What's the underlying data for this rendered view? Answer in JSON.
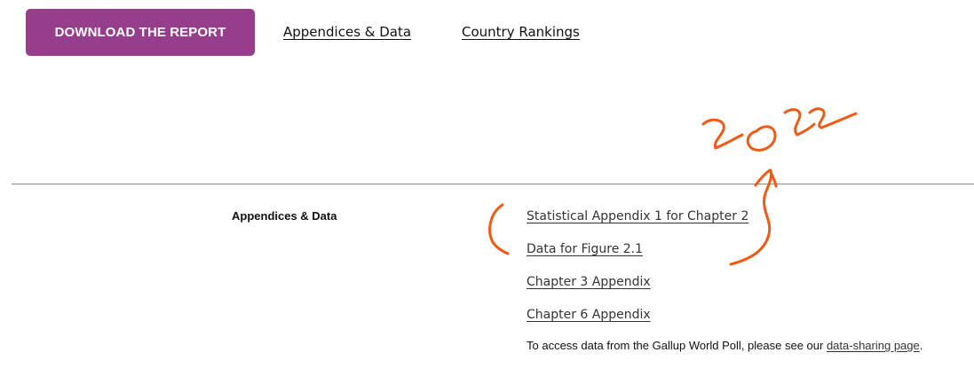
{
  "header": {
    "download_label": "DOWNLOAD THE REPORT",
    "nav_links": [
      "Appendices & Data",
      "Country Rankings"
    ]
  },
  "section": {
    "title": "Appendices & Data",
    "links": [
      "Statistical Appendix 1 for Chapter 2",
      "Data for Figure 2.1",
      "Chapter 3 Appendix",
      "Chapter 6 Appendix"
    ],
    "note_prefix": "To access data from the Gallup World Poll, please see our ",
    "note_link": "data-sharing page",
    "note_suffix": "."
  },
  "colors": {
    "brand_button": "#963d8c",
    "annotation_ink": "#f05a14"
  }
}
